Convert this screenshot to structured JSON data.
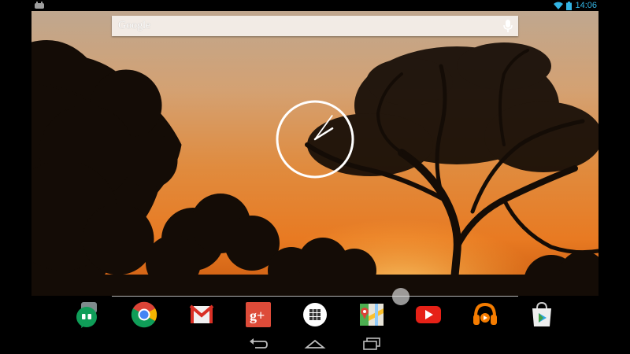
{
  "status_bar": {
    "time": "14:06",
    "icons": [
      "android-notification-icon",
      "wifi-icon",
      "battery-icon"
    ],
    "accent_color": "#33b5e5"
  },
  "search": {
    "label": "Google",
    "icon": "mic-icon"
  },
  "clock": {
    "type": "analog",
    "hour_hand_angle_deg": 58,
    "minute_hand_angle_deg": 36
  },
  "dock": {
    "items": [
      {
        "id": "hangouts",
        "icon": "hangouts-icon",
        "color": "#0f9d58"
      },
      {
        "id": "chrome",
        "icon": "chrome-icon",
        "color": "#db4437"
      },
      {
        "id": "gmail",
        "icon": "gmail-icon",
        "color": "#d93025"
      },
      {
        "id": "google-plus",
        "icon": "google-plus-icon",
        "color": "#dd4b39"
      },
      {
        "id": "all-apps",
        "icon": "app-drawer-icon",
        "color": "#ffffff"
      },
      {
        "id": "maps",
        "icon": "maps-icon",
        "color": "#4caf50"
      },
      {
        "id": "youtube",
        "icon": "youtube-icon",
        "color": "#e62117"
      },
      {
        "id": "play-music",
        "icon": "headphones-icon",
        "color": "#f57c00"
      },
      {
        "id": "play-store",
        "icon": "play-store-icon",
        "color": "#eeeeee"
      }
    ]
  },
  "nav_bar": {
    "buttons": [
      "back-icon",
      "home-icon",
      "recent-apps-icon"
    ]
  }
}
